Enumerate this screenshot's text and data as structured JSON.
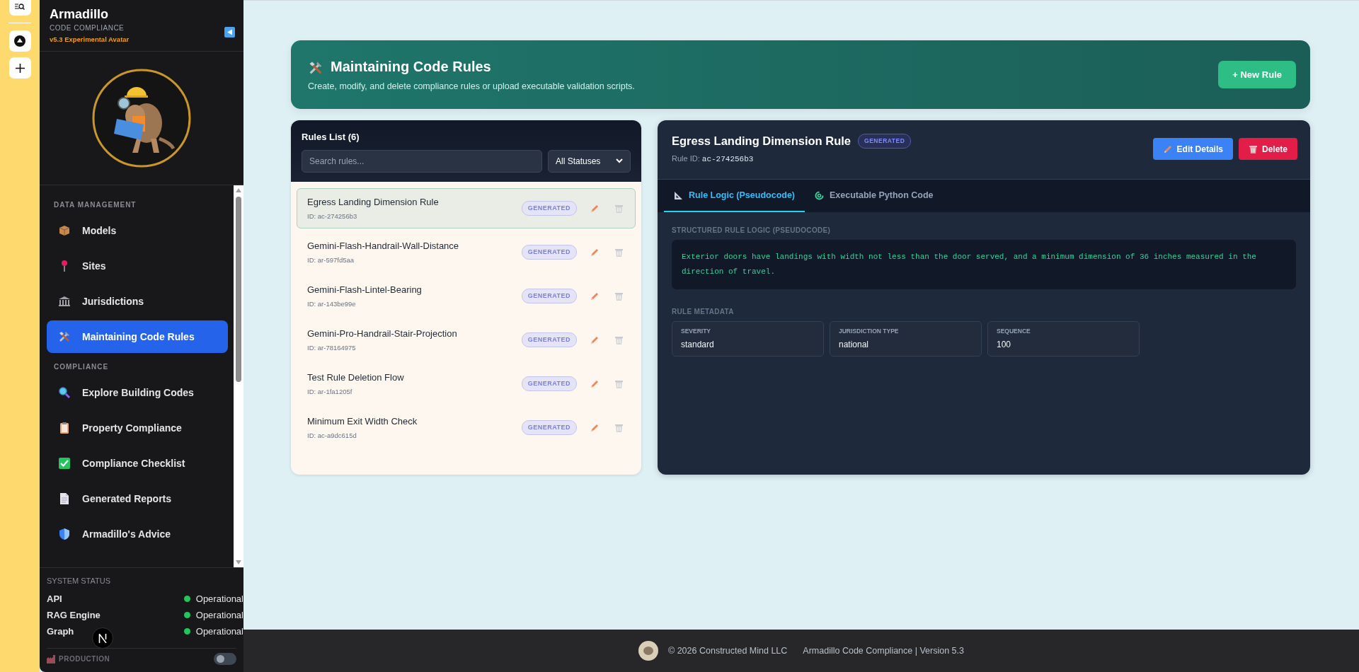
{
  "sidebar": {
    "brand": {
      "title": "Armadillo",
      "subtitle": "CODE COMPLIANCE",
      "version": "v5.3 Experimental Avatar"
    },
    "sections": [
      {
        "heading": "DATA MANAGEMENT",
        "items": [
          {
            "label": "Models",
            "selected": false
          },
          {
            "label": "Sites",
            "selected": false
          },
          {
            "label": "Jurisdictions",
            "selected": false
          },
          {
            "label": "Maintaining Code Rules",
            "selected": true
          }
        ]
      },
      {
        "heading": "COMPLIANCE",
        "items": [
          {
            "label": "Explore Building Codes",
            "selected": false
          },
          {
            "label": "Property Compliance",
            "selected": false
          },
          {
            "label": "Compliance Checklist",
            "selected": false
          },
          {
            "label": "Generated Reports",
            "selected": false
          },
          {
            "label": "Armadillo's Advice",
            "selected": false
          }
        ]
      }
    ],
    "system_status": {
      "heading": "SYSTEM STATUS",
      "services": [
        {
          "name": "API",
          "status": "Operational",
          "online": true
        },
        {
          "name": "RAG Engine",
          "status": "Operational",
          "online": true
        },
        {
          "name": "Graph",
          "status": "Operational",
          "online": true
        }
      ]
    },
    "environment": {
      "label": "PRODUCTION",
      "on": false
    }
  },
  "header": {
    "title": "Maintaining Code Rules",
    "description": "Create, modify, and delete compliance rules or upload executable validation scripts.",
    "new_button": "+ New Rule"
  },
  "rules_list": {
    "title": "Rules List (6)",
    "search": {
      "placeholder": "Search rules..."
    },
    "status_filter": "All Statuses",
    "rules": [
      {
        "name": "Egress Landing Dimension Rule",
        "id": "ID: ac-274256b3",
        "status": "GENERATED",
        "selected": true
      },
      {
        "name": "Gemini-Flash-Handrail-Wall-Distance",
        "id": "ID: ar-597fd5aa",
        "status": "GENERATED",
        "selected": false
      },
      {
        "name": "Gemini-Flash-Lintel-Bearing",
        "id": "ID: ar-143be99e",
        "status": "GENERATED",
        "selected": false
      },
      {
        "name": "Gemini-Pro-Handrail-Stair-Projection",
        "id": "ID: ar-78164975",
        "status": "GENERATED",
        "selected": false
      },
      {
        "name": "Test Rule Deletion Flow",
        "id": "ID: ar-1fa1205f",
        "status": "GENERATED",
        "selected": false
      },
      {
        "name": "Minimum Exit Width Check",
        "id": "ID: ac-a9dc615d",
        "status": "GENERATED",
        "selected": false
      }
    ]
  },
  "detail": {
    "title": "Egress Landing Dimension Rule",
    "status": "GENERATED",
    "rule_id_label": "Rule ID:",
    "rule_id": "ac-274256b3",
    "buttons": [
      {
        "label": "Edit Details",
        "kind": "edit"
      },
      {
        "label": "Delete",
        "kind": "delete"
      }
    ],
    "tabs": [
      {
        "label": "Rule Logic (Pseudocode)",
        "selected": true
      },
      {
        "label": "Executable Python Code",
        "selected": false
      }
    ],
    "logic_heading": "STRUCTURED RULE LOGIC (PSEUDOCODE)",
    "logic": "Exterior doors have landings with width not less than the door served, and a minimum dimension of 36 inches measured in the direction of travel.",
    "metadata_heading": "RULE METADATA",
    "metadata": [
      {
        "label": "SEVERITY",
        "value": "standard"
      },
      {
        "label": "JURISDICTION TYPE",
        "value": "national"
      },
      {
        "label": "SEQUENCE",
        "value": "100"
      }
    ]
  },
  "footer": {
    "copyright": "© 2026 Constructed Mind LLC",
    "product": "Armadillo Code Compliance | Version 5.3"
  }
}
